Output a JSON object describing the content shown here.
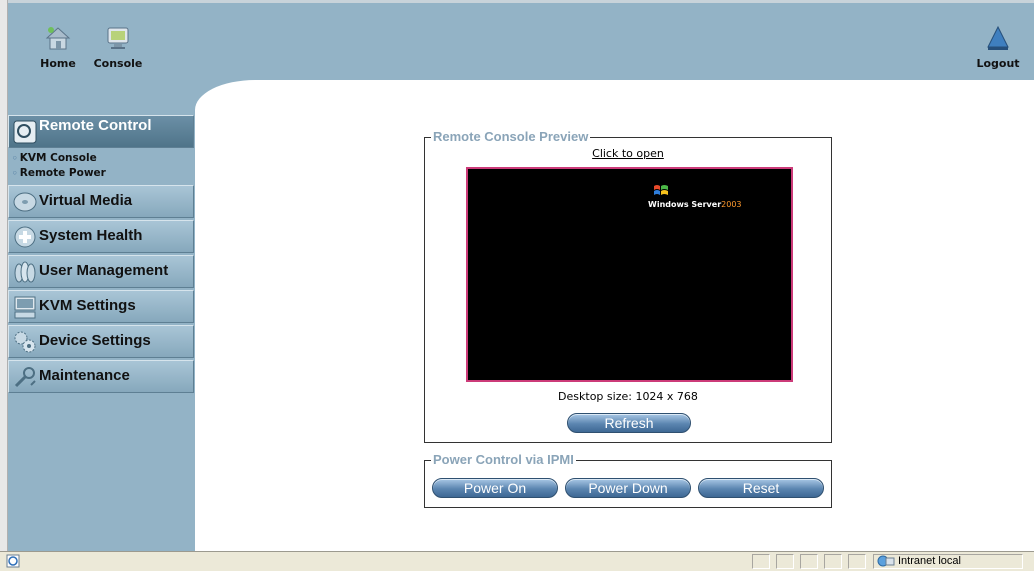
{
  "header": {
    "home_label": "Home",
    "console_label": "Console",
    "logout_label": "Logout"
  },
  "sidebar": {
    "items": [
      {
        "label": "Remote Control",
        "icon": "remote-control-icon",
        "active": true,
        "subitems": [
          {
            "label": "KVM Console"
          },
          {
            "label": "Remote Power"
          }
        ]
      },
      {
        "label": "Virtual Media",
        "icon": "virtual-media-icon"
      },
      {
        "label": "System Health",
        "icon": "system-health-icon"
      },
      {
        "label": "User Management",
        "icon": "user-management-icon"
      },
      {
        "label": "KVM Settings",
        "icon": "kvm-settings-icon"
      },
      {
        "label": "Device Settings",
        "icon": "device-settings-icon"
      },
      {
        "label": "Maintenance",
        "icon": "maintenance-icon"
      }
    ]
  },
  "preview": {
    "legend": "Remote Console Preview",
    "link": "Click to open",
    "screen_text": "Windows Server",
    "screen_year": "2003",
    "desktop_size": "Desktop size: 1024 x 768",
    "refresh_label": "Refresh"
  },
  "ipmi": {
    "legend": "Power Control via IPMI",
    "power_on_label": "Power On",
    "power_down_label": "Power Down",
    "reset_label": "Reset"
  },
  "statusbar": {
    "zone": "Intranet local"
  },
  "colors": {
    "header_bg": "#93b3c6",
    "menu_active": "#4f7489",
    "legend": "#8aa4b8",
    "screen_border": "#cc3b79",
    "button": "#3e6894"
  }
}
